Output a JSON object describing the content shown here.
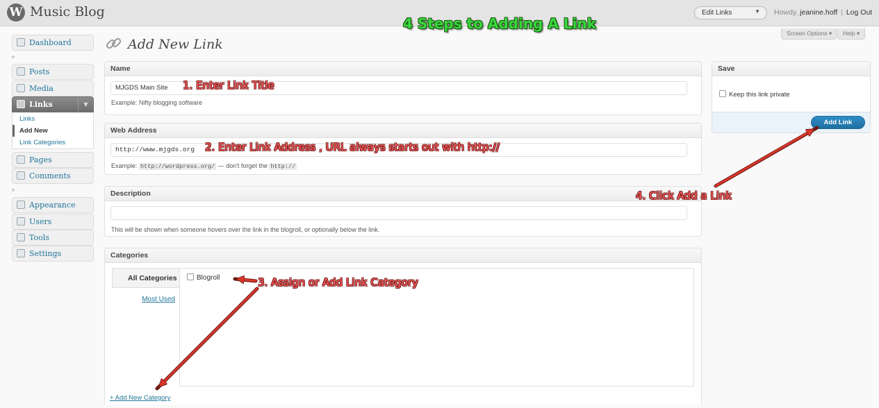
{
  "header": {
    "site_title": "Music Blog",
    "logo_glyph": "W",
    "favorite_action": "Edit Links",
    "howdy": "Howdy,",
    "username": "jeanine.hoff",
    "separator": "|",
    "logout": "Log Out"
  },
  "overlay": {
    "title": "4 Steps to Adding A Link",
    "step1": "1. Enter Link Title",
    "step2": "2. Enter Link Address , URL always starts out with http://",
    "step3": "3. Assign or Add Link Category",
    "step4": "4. Click Add a Link"
  },
  "screen_meta": {
    "screen_options": "Screen Options ▾",
    "help": "Help ▾"
  },
  "sidebar": {
    "dashboard": "Dashboard",
    "posts": "Posts",
    "media": "Media",
    "links": "Links",
    "submenu": [
      "Links",
      "Add New",
      "Link Categories"
    ],
    "pages": "Pages",
    "comments": "Comments",
    "appearance": "Appearance",
    "users": "Users",
    "tools": "Tools",
    "settings": "Settings"
  },
  "page": {
    "title": "Add New Link"
  },
  "name_box": {
    "heading": "Name",
    "value": "MJGDS Main Site",
    "example": "Example: Nifty blogging software"
  },
  "address_box": {
    "heading": "Web Address",
    "value": "http://www.mjgds.org",
    "example_prefix": "Example:",
    "example_code": "http://wordpress.org/",
    "example_mid": "— don't forget the",
    "example_code2": "http://"
  },
  "description_box": {
    "heading": "Description",
    "value": "",
    "hint": "This will be shown when someone hovers over the link in the blogroll, or optionally below the link."
  },
  "categories_box": {
    "heading": "Categories",
    "tab_all": "All Categories",
    "tab_most_used": "Most Used",
    "items": [
      "Blogroll"
    ],
    "add_new": "+ Add New Category"
  },
  "save_box": {
    "heading": "Save",
    "keep_private": "Keep this link private",
    "button": "Add Link"
  },
  "colors": {
    "link": "#21759b",
    "button": "#21759b",
    "overlay_title": "#39d63e",
    "annotation": "#ff5f5f",
    "arrow": "#d9362b"
  }
}
